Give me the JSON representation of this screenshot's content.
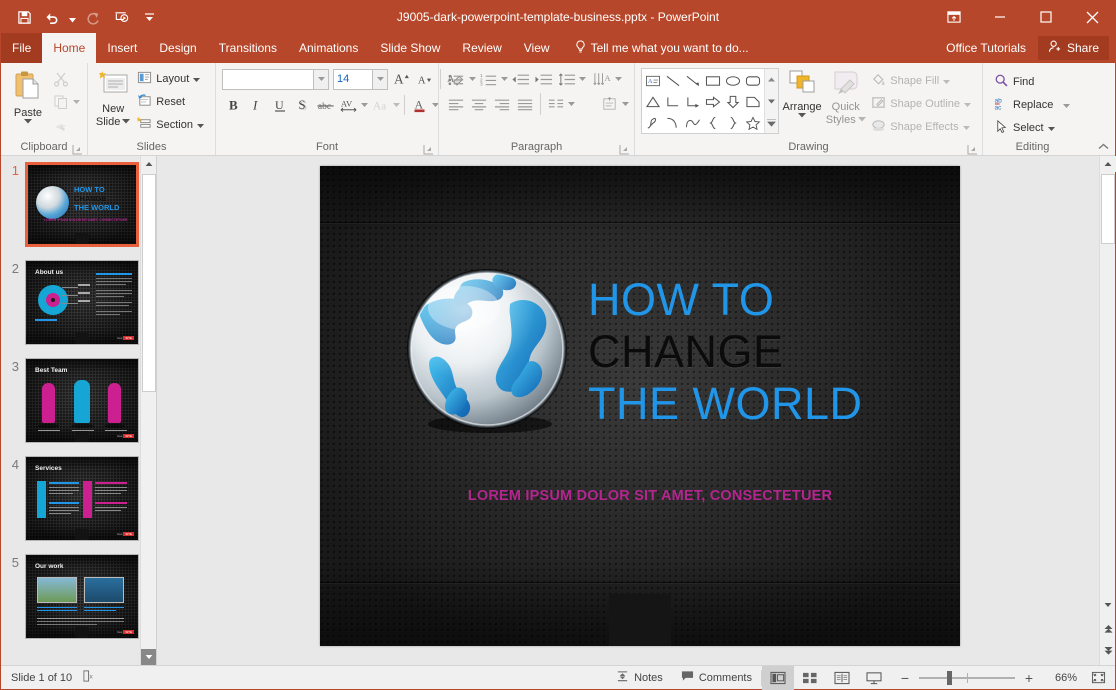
{
  "window": {
    "title": "J9005-dark-powerpoint-template-business.pptx - PowerPoint",
    "accent_color": "#b7472a",
    "quick_access": [
      {
        "name": "save",
        "label": "Save"
      },
      {
        "name": "undo",
        "label": "Undo"
      },
      {
        "name": "redo",
        "label": "Repeat"
      },
      {
        "name": "start-from-beginning",
        "label": "Start From Beginning"
      },
      {
        "name": "customize-qat",
        "label": "Customize Quick Access Toolbar"
      }
    ],
    "controls": [
      {
        "name": "ribbon-display-options",
        "label": "Ribbon Display Options"
      },
      {
        "name": "minimize",
        "label": "Minimize"
      },
      {
        "name": "restore",
        "label": "Restore Down"
      },
      {
        "name": "close",
        "label": "Close"
      }
    ]
  },
  "tabs": [
    {
      "label": "File",
      "active": false,
      "file": true
    },
    {
      "label": "Home",
      "active": true,
      "file": false
    },
    {
      "label": "Insert",
      "active": false,
      "file": false
    },
    {
      "label": "Design",
      "active": false,
      "file": false
    },
    {
      "label": "Transitions",
      "active": false,
      "file": false
    },
    {
      "label": "Animations",
      "active": false,
      "file": false
    },
    {
      "label": "Slide Show",
      "active": false,
      "file": false
    },
    {
      "label": "Review",
      "active": false,
      "file": false
    },
    {
      "label": "View",
      "active": false,
      "file": false
    }
  ],
  "tell_me": {
    "label": "Tell me what you want to do...",
    "icon": "lightbulb-icon"
  },
  "account": {
    "user": "Office Tutorials",
    "share_label": "Share",
    "share_icon": "share-person-icon"
  },
  "ribbon": {
    "groups": [
      {
        "name": "clipboard",
        "label": "Clipboard",
        "paste": {
          "label": "Paste",
          "icon": "paste-icon"
        },
        "items": [
          {
            "label": "Cut",
            "icon": "cut-icon"
          },
          {
            "label": "Copy",
            "icon": "copy-icon"
          },
          {
            "label": "Format Painter",
            "icon": "format-painter-icon"
          }
        ]
      },
      {
        "name": "slides",
        "label": "Slides",
        "new_slide": {
          "label": "New\nSlide",
          "line1": "New",
          "line2": "Slide",
          "icon": "new-slide-icon"
        },
        "items": [
          {
            "label": "Layout",
            "icon": "layout-icon"
          },
          {
            "label": "Reset",
            "icon": "reset-icon"
          },
          {
            "label": "Section",
            "icon": "section-icon"
          }
        ]
      },
      {
        "name": "font",
        "label": "Font",
        "font_name": {
          "value": "",
          "placeholder": ""
        },
        "font_size": {
          "value": "14"
        },
        "items": [
          {
            "label": "Increase Font Size",
            "icon": "increase-font-icon"
          },
          {
            "label": "Decrease Font Size",
            "icon": "decrease-font-icon"
          },
          {
            "label": "Clear All Formatting",
            "icon": "clear-formatting-icon"
          },
          {
            "label": "Bold",
            "icon": "bold-icon",
            "glyph": "B"
          },
          {
            "label": "Italic",
            "icon": "italic-icon",
            "glyph": "I"
          },
          {
            "label": "Underline",
            "icon": "underline-icon",
            "glyph": "U"
          },
          {
            "label": "Text Shadow",
            "icon": "text-shadow-icon",
            "glyph": "S"
          },
          {
            "label": "Strikethrough",
            "icon": "strikethrough-icon",
            "glyph": "abc"
          },
          {
            "label": "Character Spacing",
            "icon": "character-spacing-icon",
            "glyph": "AV"
          },
          {
            "label": "Change Case",
            "icon": "change-case-icon",
            "glyph": "Aa"
          },
          {
            "label": "Font Color",
            "icon": "font-color-icon",
            "glyph": "A"
          }
        ]
      },
      {
        "name": "paragraph",
        "label": "Paragraph",
        "items": [
          {
            "label": "Bullets",
            "icon": "bullets-icon"
          },
          {
            "label": "Numbering",
            "icon": "numbering-icon"
          },
          {
            "label": "Decrease List Level",
            "icon": "decrease-indent-icon"
          },
          {
            "label": "Increase List Level",
            "icon": "increase-indent-icon"
          },
          {
            "label": "Line Spacing",
            "icon": "line-spacing-icon"
          },
          {
            "label": "Text Direction",
            "icon": "text-direction-icon"
          },
          {
            "label": "Align Left",
            "icon": "align-left-icon"
          },
          {
            "label": "Center",
            "icon": "align-center-icon"
          },
          {
            "label": "Align Right",
            "icon": "align-right-icon"
          },
          {
            "label": "Justify",
            "icon": "align-justify-icon"
          },
          {
            "label": "Columns",
            "icon": "columns-icon"
          },
          {
            "label": "Align Text",
            "icon": "align-text-icon"
          },
          {
            "label": "Convert to SmartArt",
            "icon": "smartart-icon"
          }
        ]
      },
      {
        "name": "drawing",
        "label": "Drawing",
        "shapes": [
          "text-box-icon",
          "line-icon",
          "arrow-icon",
          "rectangle-icon",
          "oval-icon",
          "rounded-rectangle-icon",
          "triangle-icon",
          "elbow-connector-icon",
          "elbow-arrow-connector-icon",
          "right-arrow-icon",
          "down-arrow-icon",
          "pentagon-icon",
          "scribble-icon",
          "arc-icon",
          "curve-icon",
          "left-brace-icon",
          "right-brace-icon",
          "star-icon"
        ],
        "arrange": {
          "label": "Arrange",
          "icon": "arrange-icon"
        },
        "quick_styles": {
          "line1": "Quick",
          "line2": "Styles",
          "icon": "quick-styles-icon"
        },
        "items": [
          {
            "label": "Shape Fill",
            "icon": "shape-fill-icon"
          },
          {
            "label": "Shape Outline",
            "icon": "shape-outline-icon"
          },
          {
            "label": "Shape Effects",
            "icon": "shape-effects-icon"
          }
        ]
      },
      {
        "name": "editing",
        "label": "Editing",
        "items": [
          {
            "label": "Find",
            "icon": "find-icon"
          },
          {
            "label": "Replace",
            "icon": "replace-icon"
          },
          {
            "label": "Select",
            "icon": "select-icon"
          }
        ]
      }
    ],
    "collapse": {
      "label": "Collapse the Ribbon",
      "icon": "chevron-up-icon"
    }
  },
  "thumbnails": [
    {
      "number": "1",
      "title": "HOW TO CHANGE THE WORLD",
      "kind": "title",
      "selected": true
    },
    {
      "number": "2",
      "title": "About us",
      "kind": "about",
      "selected": false
    },
    {
      "number": "3",
      "title": "Best Team",
      "kind": "team",
      "selected": false
    },
    {
      "number": "4",
      "title": "Services",
      "kind": "services",
      "selected": false
    },
    {
      "number": "5",
      "title": "Our work",
      "kind": "work",
      "selected": false
    }
  ],
  "slide": {
    "title_lines": [
      {
        "text": "HOW TO",
        "color": "#2196e8"
      },
      {
        "text": "CHANGE",
        "color": "#0b0b0b"
      },
      {
        "text": "THE WORLD",
        "color": "#2196e8"
      }
    ],
    "subtitle": "LOREM IPSUM DOLOR SIT AMET, CONSECTETUER",
    "subtitle_color": "#b5258f",
    "background_color": "#2e2e2e",
    "graphic": "globe-image"
  },
  "status": {
    "slide_indicator": "Slide 1 of 10",
    "language_icon": "spell-check-icon",
    "notes": {
      "label": "Notes",
      "icon": "notes-icon"
    },
    "comments": {
      "label": "Comments",
      "icon": "comments-icon"
    },
    "views": [
      {
        "name": "normal-view",
        "label": "Normal",
        "active": true
      },
      {
        "name": "slide-sorter-view",
        "label": "Slide Sorter",
        "active": false
      },
      {
        "name": "reading-view",
        "label": "Reading View",
        "active": false
      },
      {
        "name": "slide-show-view",
        "label": "Slide Show",
        "active": false
      }
    ],
    "zoom": {
      "value": "66%",
      "out_label": "Zoom Out",
      "in_label": "Zoom In"
    },
    "fit_label": "Fit slide to current window"
  }
}
